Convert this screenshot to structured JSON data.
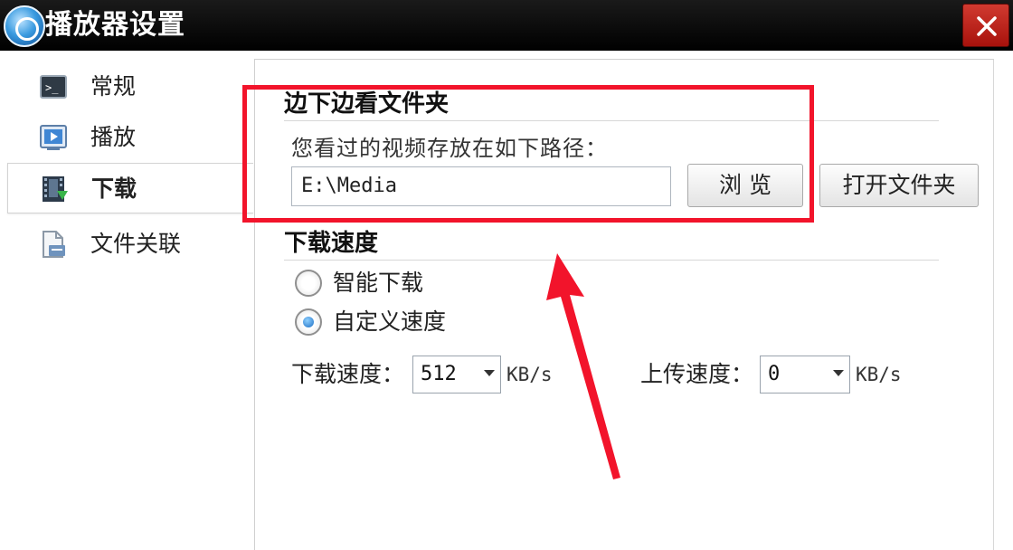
{
  "window": {
    "title": "播放器设置",
    "logo_icon": "player-logo-icon",
    "close_icon": "close-icon"
  },
  "sidebar": {
    "items": [
      {
        "label": "常规",
        "icon": "terminal-icon",
        "active": false
      },
      {
        "label": "播放",
        "icon": "play-icon",
        "active": false
      },
      {
        "label": "下载",
        "icon": "film-download-icon",
        "active": true
      },
      {
        "label": "文件关联",
        "icon": "file-association-icon",
        "active": false
      }
    ]
  },
  "download_folder": {
    "title": "边下边看文件夹",
    "description": "您看过的视频存放在如下路径：",
    "path_value": "E:\\Media",
    "browse_label": "浏 览",
    "open_folder_label": "打开文件夹"
  },
  "download_speed": {
    "title": "下载速度",
    "options": [
      {
        "label": "智能下载",
        "checked": false
      },
      {
        "label": "自定义速度",
        "checked": true
      }
    ],
    "download": {
      "label": "下载速度：",
      "value": "512",
      "unit": "KB/s"
    },
    "upload": {
      "label": "上传速度：",
      "value": "0",
      "unit": "KB/s"
    }
  },
  "colors": {
    "titlebar": "#000000",
    "close_button": "#c0261d",
    "annotation": "#f2142b",
    "radio_selected": "#1d6fc4"
  }
}
